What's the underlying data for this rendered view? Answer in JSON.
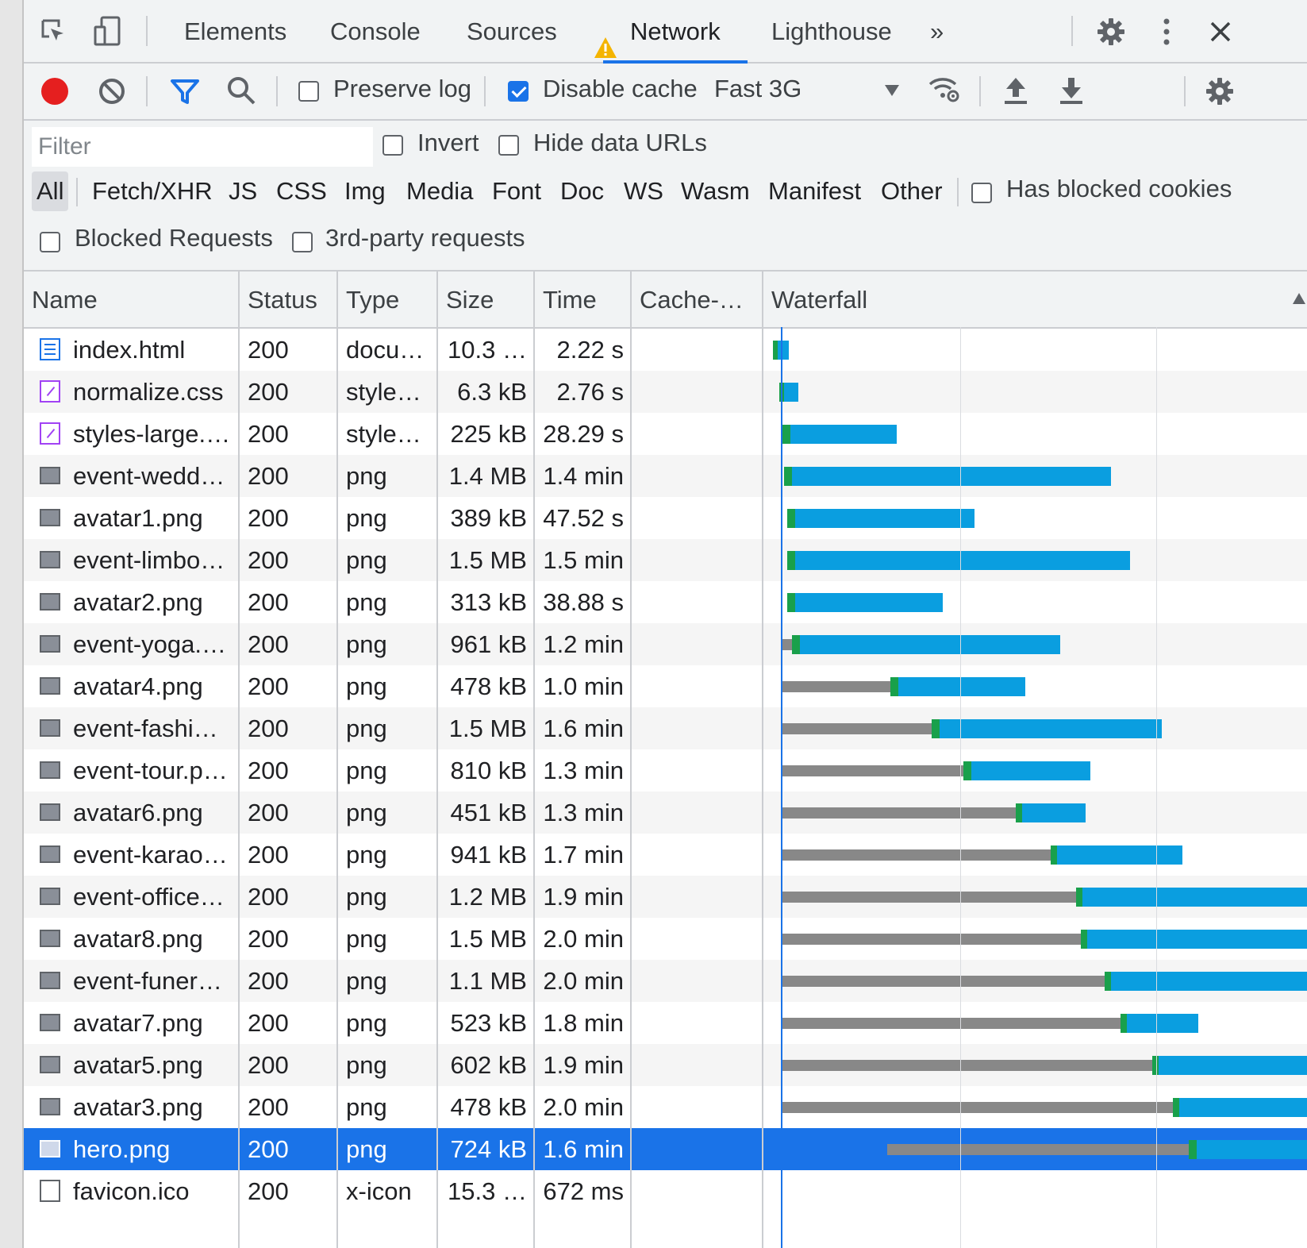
{
  "tabs": {
    "items": [
      {
        "label": "Elements"
      },
      {
        "label": "Console"
      },
      {
        "label": "Sources"
      },
      {
        "label": "Network",
        "active": true,
        "warning": true
      },
      {
        "label": "Lighthouse"
      }
    ],
    "more": "»"
  },
  "toolbar": {
    "preserve_log": {
      "label": "Preserve log",
      "checked": false
    },
    "disable_cache": {
      "label": "Disable cache",
      "checked": true
    },
    "throttle": "Fast 3G"
  },
  "filter": {
    "placeholder": "Filter",
    "invert": {
      "label": "Invert",
      "checked": false
    },
    "hide_data_urls": {
      "label": "Hide data URLs",
      "checked": false
    },
    "types": [
      "All",
      "Fetch/XHR",
      "JS",
      "CSS",
      "Img",
      "Media",
      "Font",
      "Doc",
      "WS",
      "Wasm",
      "Manifest",
      "Other"
    ],
    "selected_type": "All",
    "has_blocked_cookies": {
      "label": "Has blocked cookies",
      "checked": false
    },
    "blocked_requests": {
      "label": "Blocked Requests",
      "checked": false
    },
    "third_party": {
      "label": "3rd-party requests",
      "checked": false
    }
  },
  "table": {
    "columns": [
      "Name",
      "Status",
      "Type",
      "Size",
      "Time",
      "Cache-…",
      "Waterfall"
    ],
    "rows": [
      {
        "name": "index.html",
        "status": "200",
        "type": "docu…",
        "size": "10.3 …",
        "time": "2.22 s",
        "icon": "document-icon"
      },
      {
        "name": "normalize.css",
        "status": "200",
        "type": "style…",
        "size": "6.3 kB",
        "time": "2.76 s",
        "icon": "stylesheet-icon"
      },
      {
        "name": "styles-large.…",
        "status": "200",
        "type": "style…",
        "size": "225 kB",
        "time": "28.29 s",
        "icon": "stylesheet-icon"
      },
      {
        "name": "event-wedd…",
        "status": "200",
        "type": "png",
        "size": "1.4 MB",
        "time": "1.4 min",
        "icon": "image-icon"
      },
      {
        "name": "avatar1.png",
        "status": "200",
        "type": "png",
        "size": "389 kB",
        "time": "47.52 s",
        "icon": "image-icon"
      },
      {
        "name": "event-limbo…",
        "status": "200",
        "type": "png",
        "size": "1.5 MB",
        "time": "1.5 min",
        "icon": "image-icon"
      },
      {
        "name": "avatar2.png",
        "status": "200",
        "type": "png",
        "size": "313 kB",
        "time": "38.88 s",
        "icon": "image-icon"
      },
      {
        "name": "event-yoga.…",
        "status": "200",
        "type": "png",
        "size": "961 kB",
        "time": "1.2 min",
        "icon": "image-icon"
      },
      {
        "name": "avatar4.png",
        "status": "200",
        "type": "png",
        "size": "478 kB",
        "time": "1.0 min",
        "icon": "image-icon"
      },
      {
        "name": "event-fashi…",
        "status": "200",
        "type": "png",
        "size": "1.5 MB",
        "time": "1.6 min",
        "icon": "image-icon"
      },
      {
        "name": "event-tour.p…",
        "status": "200",
        "type": "png",
        "size": "810 kB",
        "time": "1.3 min",
        "icon": "image-icon"
      },
      {
        "name": "avatar6.png",
        "status": "200",
        "type": "png",
        "size": "451 kB",
        "time": "1.3 min",
        "icon": "image-icon"
      },
      {
        "name": "event-karao…",
        "status": "200",
        "type": "png",
        "size": "941 kB",
        "time": "1.7 min",
        "icon": "image-icon"
      },
      {
        "name": "event-office…",
        "status": "200",
        "type": "png",
        "size": "1.2 MB",
        "time": "1.9 min",
        "icon": "image-icon"
      },
      {
        "name": "avatar8.png",
        "status": "200",
        "type": "png",
        "size": "1.5 MB",
        "time": "2.0 min",
        "icon": "image-icon"
      },
      {
        "name": "event-funer…",
        "status": "200",
        "type": "png",
        "size": "1.1 MB",
        "time": "2.0 min",
        "icon": "image-icon"
      },
      {
        "name": "avatar7.png",
        "status": "200",
        "type": "png",
        "size": "523 kB",
        "time": "1.8 min",
        "icon": "image-icon"
      },
      {
        "name": "avatar5.png",
        "status": "200",
        "type": "png",
        "size": "602 kB",
        "time": "1.9 min",
        "icon": "image-icon"
      },
      {
        "name": "avatar3.png",
        "status": "200",
        "type": "png",
        "size": "478 kB",
        "time": "2.0 min",
        "icon": "image-icon"
      },
      {
        "name": "hero.png",
        "status": "200",
        "type": "png",
        "size": "724 kB",
        "time": "1.6 min",
        "icon": "image-icon",
        "selected": true
      },
      {
        "name": "favicon.ico",
        "status": "200",
        "type": "x-icon",
        "size": "15.3 …",
        "time": "672 ms",
        "icon": "file-icon"
      }
    ]
  },
  "colors": {
    "accent": "#1a73e8",
    "waiting": "#888888",
    "ttfb": "#19a04b",
    "download": "#0a9ee0",
    "record": "#e51f1f",
    "warning": "#f4b400"
  }
}
